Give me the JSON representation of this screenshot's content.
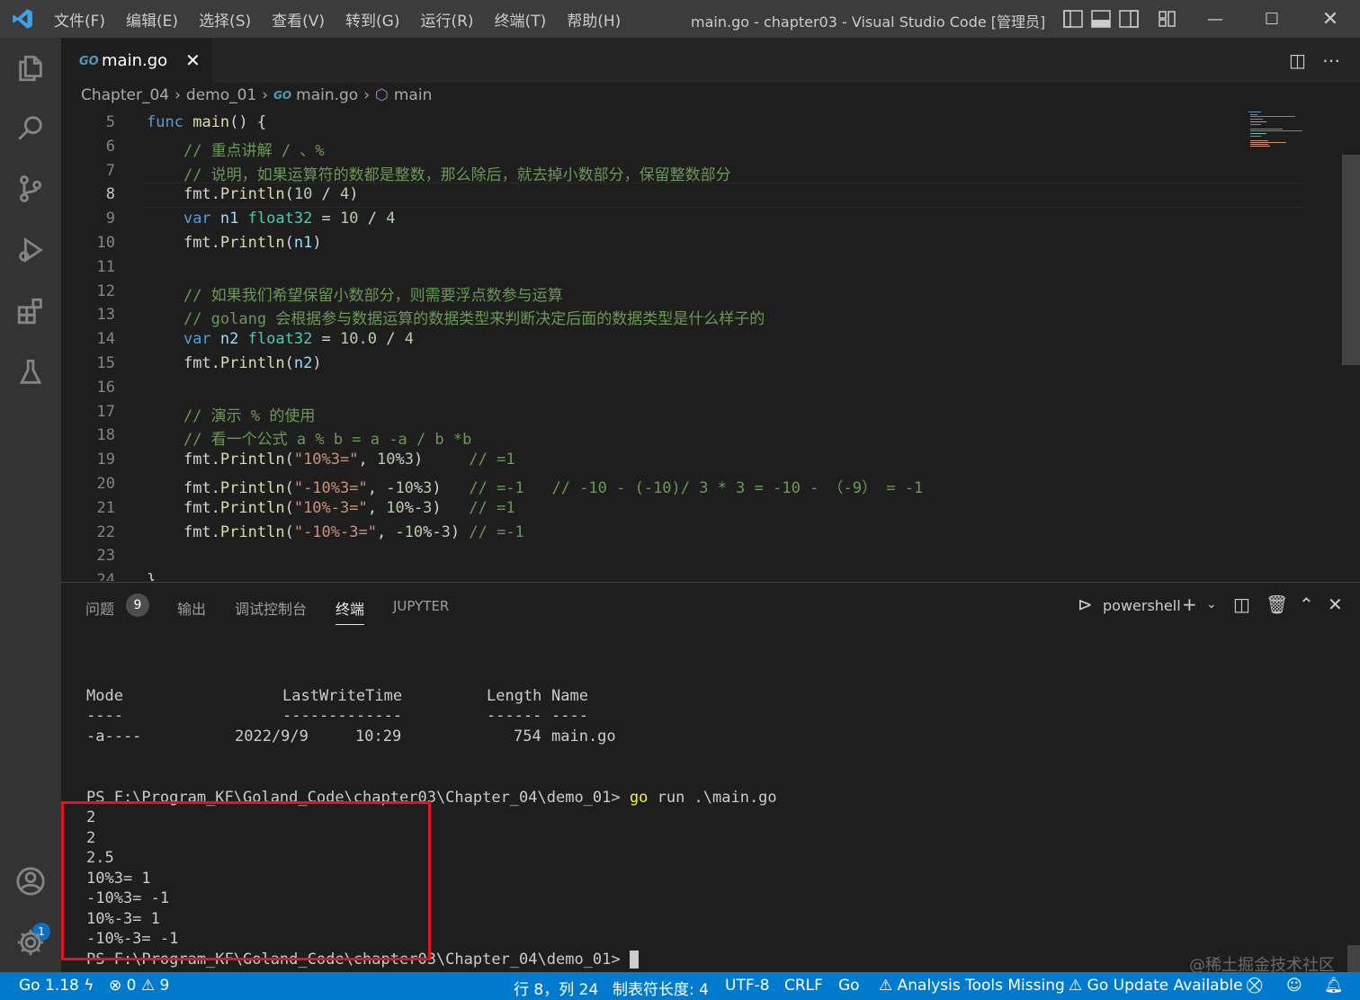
{
  "window": {
    "menu": [
      "文件(F)",
      "编辑(E)",
      "选择(S)",
      "查看(V)",
      "转到(G)",
      "运行(R)",
      "终端(T)",
      "帮助(H)"
    ],
    "title": "main.go - chapter03 - Visual Studio Code [管理员]"
  },
  "activity_bar": {
    "items": [
      "explorer-icon",
      "search-icon",
      "source-control-icon",
      "run-debug-icon",
      "extensions-icon",
      "testing-icon"
    ],
    "accounts_badge": "1"
  },
  "tabs": [
    {
      "icon": "GO",
      "label": "main.go",
      "close": "✕"
    }
  ],
  "breadcrumb": {
    "items": [
      "Chapter_04",
      "demo_01",
      "main.go",
      "main"
    ],
    "go_icon": "GO",
    "separator": "›"
  },
  "editor": {
    "lines": [
      {
        "n": "5",
        "code": "func main() {"
      },
      {
        "n": "6",
        "code": "    // 重点讲解 / 、%"
      },
      {
        "n": "7",
        "code": "    // 说明，如果运算符的数都是整数，那么除后，就去掉小数部分，保留整数部分"
      },
      {
        "n": "8",
        "code": "    fmt.Println(10 / 4)"
      },
      {
        "n": "9",
        "code": "    var n1 float32 = 10 / 4"
      },
      {
        "n": "10",
        "code": "    fmt.Println(n1)"
      },
      {
        "n": "11",
        "code": ""
      },
      {
        "n": "12",
        "code": "    // 如果我们希望保留小数部分，则需要浮点数参与运算"
      },
      {
        "n": "13",
        "code": "    // golang 会根据参与数据运算的数据类型来判断决定后面的数据类型是什么样子的"
      },
      {
        "n": "14",
        "code": "    var n2 float32 = 10.0 / 4"
      },
      {
        "n": "15",
        "code": "    fmt.Println(n2)"
      },
      {
        "n": "16",
        "code": ""
      },
      {
        "n": "17",
        "code": "    // 演示 % 的使用"
      },
      {
        "n": "18",
        "code": "    // 看一个公式 a % b = a -a / b *b"
      },
      {
        "n": "19",
        "code": "    fmt.Println(\"10%3=\", 10%3)     // =1"
      },
      {
        "n": "20",
        "code": "    fmt.Println(\"-10%3=\", -10%3)   // =-1   // -10 - (-10)/ 3 * 3 = -10 - （-9） = -1"
      },
      {
        "n": "21",
        "code": "    fmt.Println(\"10%-3=\", 10%-3)   // =1"
      },
      {
        "n": "22",
        "code": "    fmt.Println(\"-10%-3=\", -10%-3) // =-1"
      },
      {
        "n": "23",
        "code": ""
      },
      {
        "n": "24",
        "code": "}"
      }
    ],
    "active_line": "8"
  },
  "panel": {
    "tabs": [
      "问题",
      "输出",
      "调试控制台",
      "终端",
      "JUPYTER"
    ],
    "problems_count": "9",
    "active_tab": "终端",
    "shell": "powershell",
    "terminal": {
      "header": [
        "Mode",
        "LastWriteTime",
        "Length",
        "Name"
      ],
      "underline": [
        "----",
        "-------------",
        "------",
        "----"
      ],
      "row": [
        "-a----",
        "2022/9/9",
        "10:29",
        "754",
        "main.go"
      ],
      "prompt": "PS F:\\Program_KF\\Goland_Code\\chapter03\\Chapter_04\\demo_01>",
      "command_go": "go",
      "command_rest": " run .\\main.go",
      "output": [
        "2",
        "2",
        "2.5",
        "10%3= 1",
        "-10%3= -1",
        "10%-3= 1",
        "-10%-3= -1"
      ],
      "prompt2": "PS F:\\Program_KF\\Goland_Code\\chapter03\\Chapter_04\\demo_01>"
    },
    "watermark": "@稀土掘金技术社区"
  },
  "statusbar": {
    "go_version": "Go 1.18",
    "errors": "0",
    "warnings": "9",
    "position": "行 8，列 24",
    "tab_size": "制表符长度: 4",
    "encoding": "UTF-8",
    "eol": "CRLF",
    "language": "Go",
    "analysis": "Analysis Tools Missing",
    "update": "Go Update Available"
  },
  "colors": {
    "accent": "#007acc",
    "highlight_box": "#e81123"
  }
}
